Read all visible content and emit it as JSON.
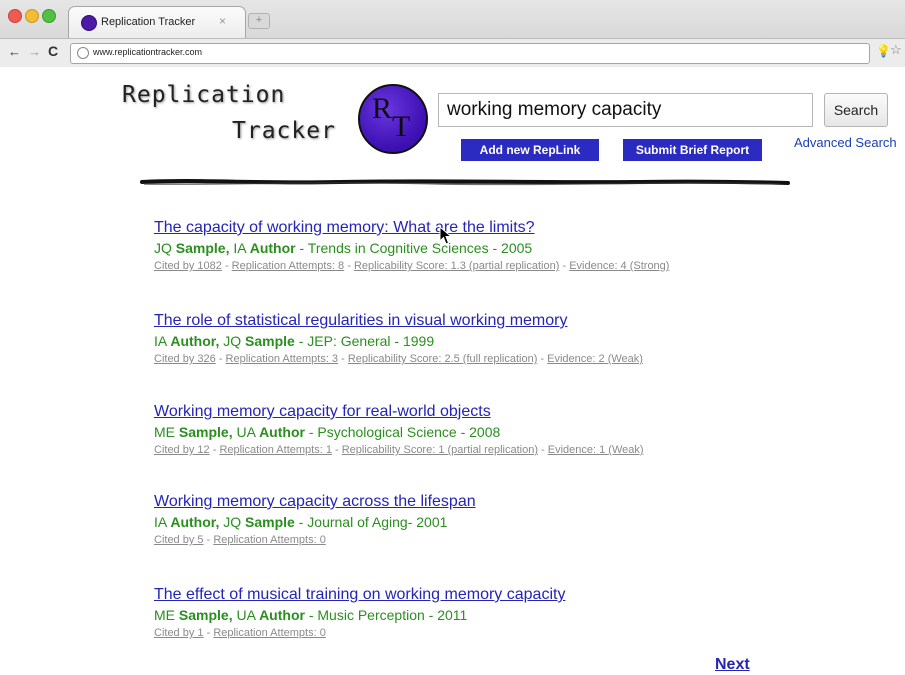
{
  "browser": {
    "tab_title": "Replication Tracker",
    "tab_close": "×",
    "newtab_label": "+",
    "url": "www.replicationtracker.com",
    "nav": {
      "back": "←",
      "forward": "→",
      "reload": "C"
    }
  },
  "header": {
    "logo_line1": "Replication",
    "logo_line2": "Tracker",
    "logo_mark_r": "R",
    "logo_mark_t": "T",
    "search_value": "working memory capacity",
    "search_button": "Search",
    "advanced_search": "Advanced Search",
    "add_replink": "Add new RepLink",
    "submit_report": "Submit Brief Report"
  },
  "results": [
    {
      "title": "The capacity of working memory: What are the limits?",
      "a1_initials": "JQ ",
      "a1_name": "Sample,",
      "a2_initials": " IA ",
      "a2_name": "Author",
      "source": " - Trends in Cognitive Sciences - 2005",
      "cited": "Cited by 1082",
      "attempts": "Replication Attempts: 8",
      "score": "Replicability Score: 1.3 (partial replication)",
      "evidence": "Evidence: 4 (Strong)"
    },
    {
      "title": "The role of statistical regularities in visual working memory",
      "a1_initials": "IA ",
      "a1_name": "Author,",
      "a2_initials": " JQ ",
      "a2_name": "Sample",
      "source": " - JEP: General - 1999",
      "cited": "Cited by 326",
      "attempts": "Replication Attempts: 3",
      "score": "Replicability Score: 2.5 (full replication)",
      "evidence": "Evidence: 2 (Weak)"
    },
    {
      "title": "Working memory capacity for real-world objects",
      "a1_initials": "ME ",
      "a1_name": "Sample,",
      "a2_initials": " UA ",
      "a2_name": "Author",
      "source": "  - Psychological Science - 2008",
      "cited": "Cited by 12",
      "attempts": "Replication Attempts: 1",
      "score": "Replicability Score: 1 (partial replication)",
      "evidence": "Evidence: 1 (Weak)"
    },
    {
      "title": "Working memory capacity across the lifespan",
      "a1_initials": "IA ",
      "a1_name": "Author,",
      "a2_initials": " JQ ",
      "a2_name": "Sample",
      "source": " - Journal of Aging- 2001",
      "cited": "Cited by 5",
      "attempts": "Replication Attempts: 0"
    },
    {
      "title": "The effect of musical training on working memory capacity",
      "a1_initials": "ME ",
      "a1_name": "Sample,",
      "a2_initials": " UA ",
      "a2_name": "Author",
      "source": "  - Music Perception - 2011",
      "cited": "Cited by 1",
      "attempts": "Replication Attempts: 0"
    }
  ],
  "pagination": {
    "next": "Next"
  },
  "separators": {
    "meta": " - "
  },
  "colors": {
    "link": "#2424b8",
    "byline": "#2a8f1e",
    "meta": "#8a8a8a",
    "button": "#2b2bc1",
    "logo": "#4b1aa6"
  }
}
